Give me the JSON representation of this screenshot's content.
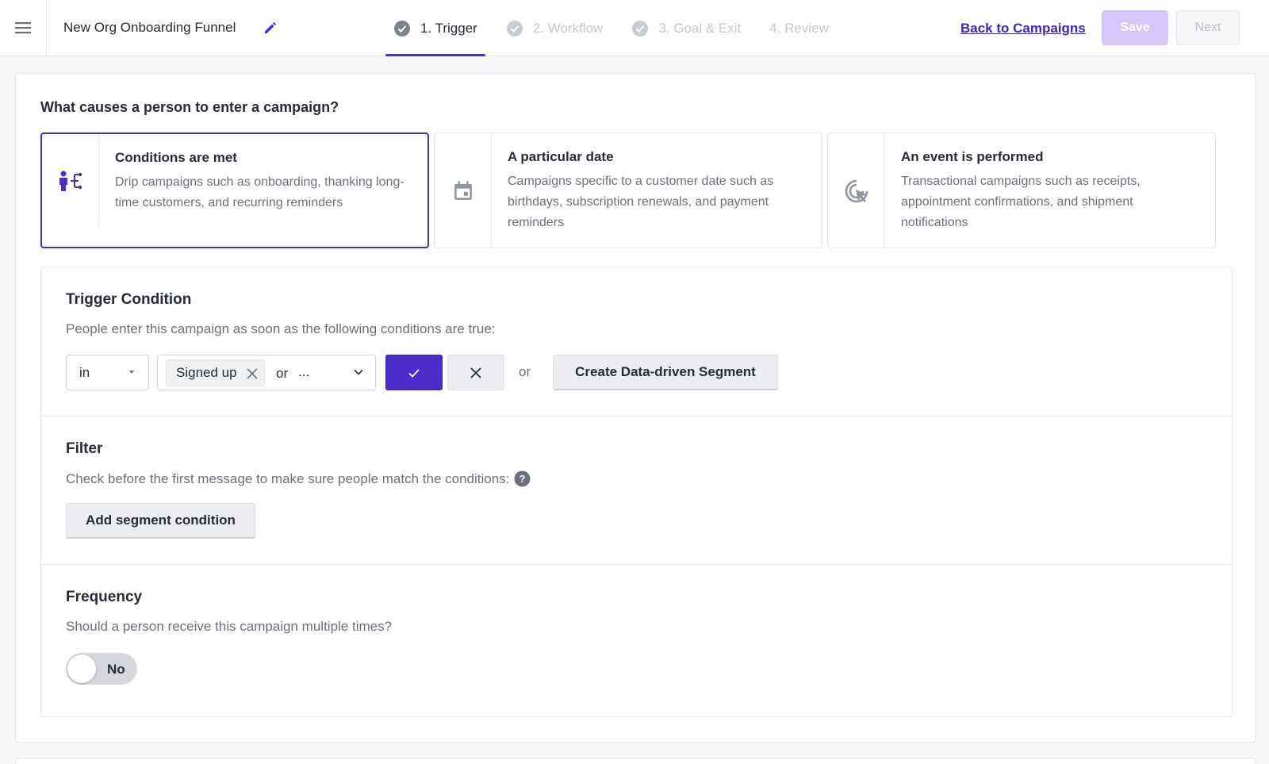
{
  "header": {
    "campaign_title": "New Org Onboarding Funnel",
    "steps": [
      {
        "label": "1. Trigger",
        "state": "active"
      },
      {
        "label": "2. Workflow",
        "state": "inactive"
      },
      {
        "label": "3. Goal & Exit",
        "state": "inactive"
      },
      {
        "label": "4. Review",
        "state": "inactive"
      }
    ],
    "back_link": "Back to Campaigns",
    "save_label": "Save",
    "next_label": "Next"
  },
  "main": {
    "question": "What causes a person to enter a campaign?",
    "options": [
      {
        "title": "Conditions are met",
        "desc": "Drip campaigns such as onboarding, thanking long-time customers, and recurring reminders",
        "icon": "branch-person-icon",
        "selected": true
      },
      {
        "title": "A particular date",
        "desc": "Campaigns specific to a customer date such as birthdays, subscription renewals, and payment reminders",
        "icon": "calendar-icon",
        "selected": false
      },
      {
        "title": "An event is performed",
        "desc": "Transactional campaigns such as receipts, appointment confirmations, and shipment notifications",
        "icon": "cursor-click-icon",
        "selected": false
      }
    ],
    "trigger": {
      "title": "Trigger Condition",
      "desc": "People enter this campaign as soon as the following conditions are true:",
      "operator_value": "in",
      "chip": "Signed up",
      "or_text": "or",
      "more_text": "...",
      "or_between": "or",
      "segment_button": "Create Data-driven Segment"
    },
    "filter": {
      "title": "Filter",
      "desc": "Check before the first message to make sure people match the conditions:",
      "add_button": "Add segment condition"
    },
    "frequency": {
      "title": "Frequency",
      "desc": "Should a person receive this campaign multiple times?",
      "toggle_label": "No",
      "toggle_on": false
    }
  },
  "colors": {
    "accent": "#4b2dc9",
    "link": "#4022c9",
    "save_disabled": "#d4c8fb"
  }
}
